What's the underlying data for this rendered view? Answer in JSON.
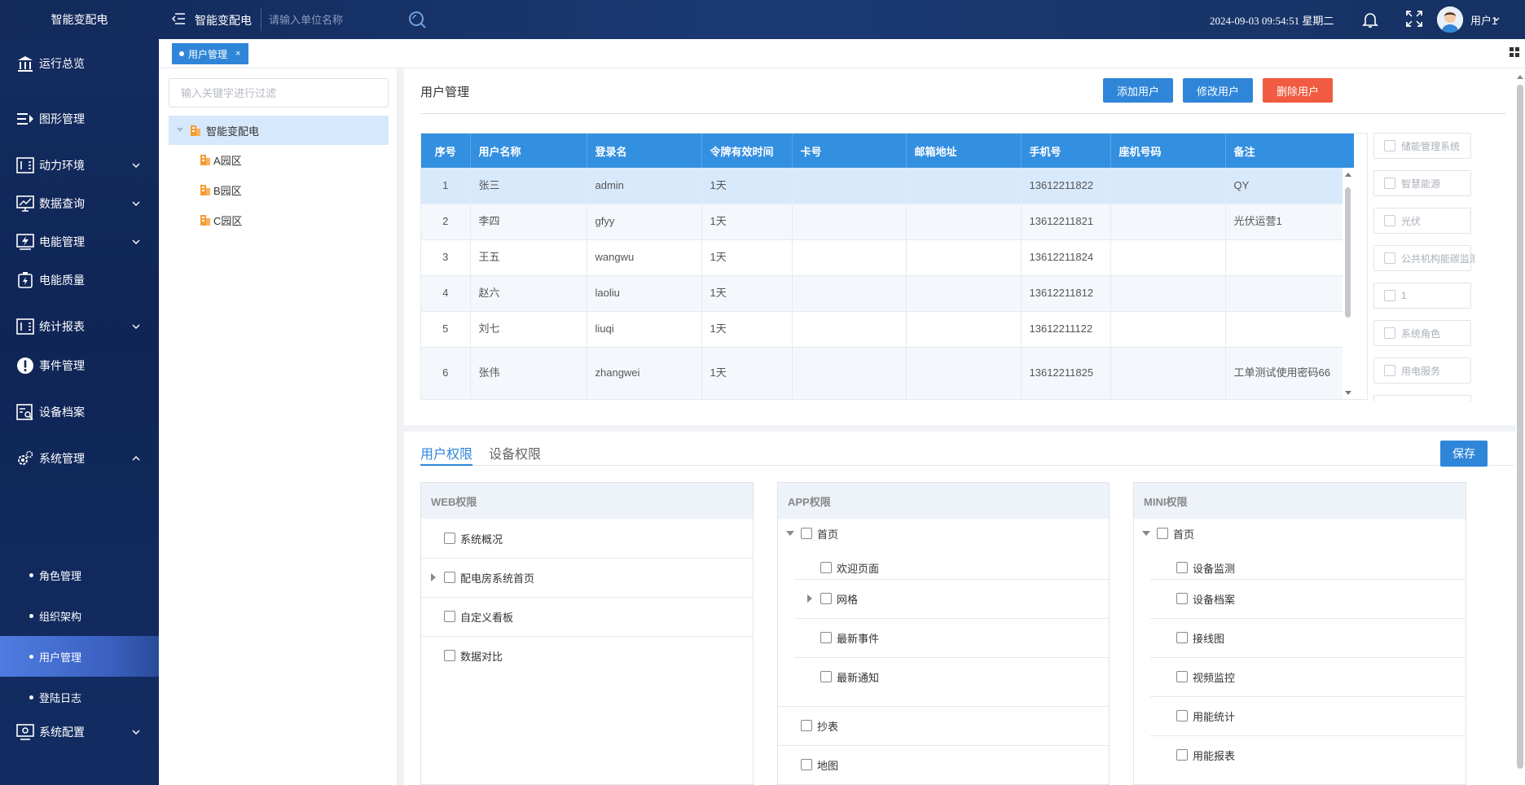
{
  "app": {
    "brand": "智能变配电",
    "system_title": "智能变配电",
    "search_placeholder": "请输入单位名称",
    "datetime": "2024-09-03 09:54:51 星期二",
    "user": "用户1"
  },
  "sidebar": {
    "items": [
      {
        "label": "运行总览",
        "icon": "bank-icon",
        "chevron": false
      },
      {
        "label": "图形管理",
        "icon": "menu-arrow-icon",
        "chevron": false
      },
      {
        "label": "动力环境",
        "icon": "panel-icon",
        "chevron": true
      },
      {
        "label": "数据查询",
        "icon": "monitor-chart-icon",
        "chevron": true
      },
      {
        "label": "电能管理",
        "icon": "energy-icon",
        "chevron": true
      },
      {
        "label": "电能质量",
        "icon": "battery-icon",
        "chevron": false
      },
      {
        "label": "统计报表",
        "icon": "report-icon",
        "chevron": true
      },
      {
        "label": "事件管理",
        "icon": "alert-icon",
        "chevron": false
      },
      {
        "label": "设备档案",
        "icon": "device-search-icon",
        "chevron": false
      },
      {
        "label": "系统管理",
        "icon": "gears-icon",
        "chevron": "up"
      }
    ],
    "subitems": [
      {
        "label": "角色管理",
        "active": false
      },
      {
        "label": "组织架构",
        "active": false
      },
      {
        "label": "用户管理",
        "active": true
      },
      {
        "label": "登陆日志",
        "active": false
      }
    ],
    "last": {
      "label": "系统配置",
      "icon": "config-icon",
      "chevron": true
    }
  },
  "tabs": [
    {
      "label": "用户管理",
      "close": "×"
    }
  ],
  "tree": {
    "filter_placeholder": "输入关键字进行过滤",
    "root": "智能变配电",
    "children": [
      "A园区",
      "B园区",
      "C园区"
    ]
  },
  "main": {
    "title": "用户管理",
    "buttons": {
      "add": "添加用户",
      "edit": "修改用户",
      "delete": "删除用户"
    },
    "columns": [
      "序号",
      "用户名称",
      "登录名",
      "令牌有效时间",
      "卡号",
      "邮箱地址",
      "手机号",
      "座机号码",
      "备注"
    ],
    "rows": [
      [
        "1",
        "张三",
        "admin",
        "1天",
        "",
        "",
        "13612211822",
        "",
        "QY"
      ],
      [
        "2",
        "李四",
        "gfyy",
        "1天",
        "",
        "",
        "13612211821",
        "",
        "光伏运营1"
      ],
      [
        "3",
        "王五",
        "wangwu",
        "1天",
        "",
        "",
        "13612211824",
        "",
        ""
      ],
      [
        "4",
        "赵六",
        "laoliu",
        "1天",
        "",
        "",
        "13612211812",
        "",
        ""
      ],
      [
        "5",
        "刘七",
        "liuqi",
        "1天",
        "",
        "",
        "13612211122",
        "",
        ""
      ],
      [
        "6",
        "张伟",
        "zhangwei",
        "1天",
        "",
        "",
        "13612211825",
        "",
        "工单测试使用密码66"
      ]
    ],
    "roles": [
      "储能管理系统",
      "智慧能源",
      "光伏",
      "公共机构能碳监测管理",
      "1",
      "系统角色",
      "用电服务"
    ]
  },
  "permissions": {
    "tabs": [
      "用户权限",
      "设备权限"
    ],
    "save": "保存",
    "web": {
      "title": "WEB权限",
      "items": [
        "系统概况",
        "配电房系统首页",
        "自定义看板",
        "数据对比"
      ]
    },
    "app": {
      "title": "APP权限",
      "root": "首页",
      "children": [
        "欢迎页面",
        "网格",
        "最新事件",
        "最新通知"
      ],
      "others": [
        "抄表",
        "地图"
      ]
    },
    "mini": {
      "title": "MINI权限",
      "root": "首页",
      "children": [
        "设备监测",
        "设备档案",
        "接线图",
        "视频监控",
        "用能统计",
        "用能报表"
      ]
    }
  },
  "colors": {
    "primary": "#2f86d9",
    "danger": "#f05b41",
    "sidebar": "#0f2556",
    "active": "#4f7ce0"
  }
}
